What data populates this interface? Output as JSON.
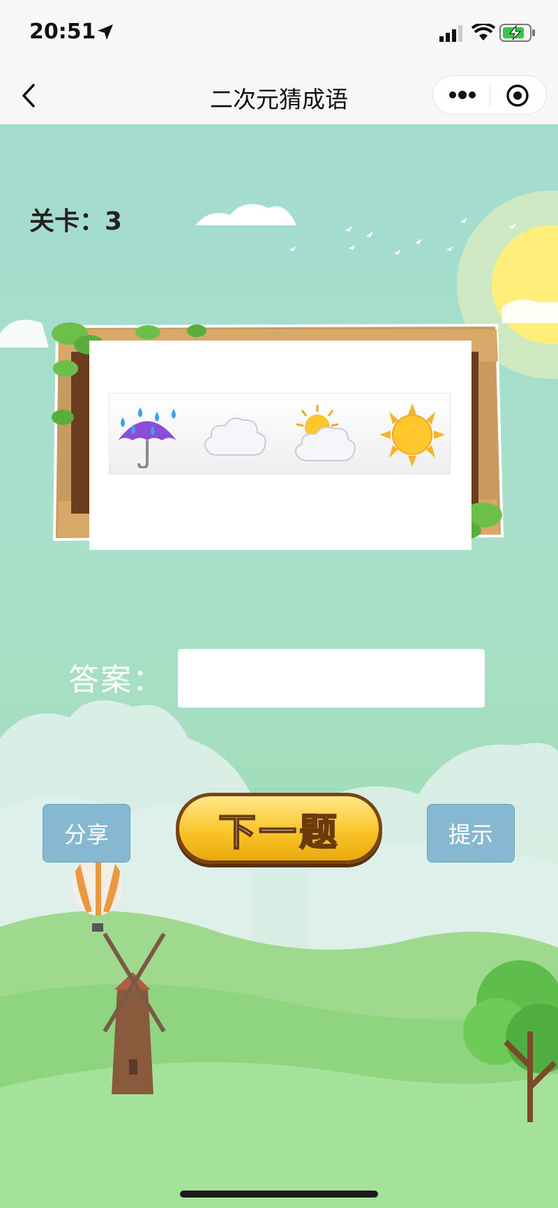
{
  "status_bar": {
    "time": "20:51"
  },
  "nav": {
    "title": "二次元猜成语"
  },
  "game": {
    "level_label": "关卡：3"
  },
  "puzzle": {
    "emoji": [
      "umbrella-with-rain-drops",
      "cloud",
      "sun-behind-cloud",
      "sun"
    ]
  },
  "answer": {
    "label": "答案：",
    "value": "",
    "placeholder": ""
  },
  "buttons": {
    "share": "分享",
    "next": "下一题",
    "hint": "提示"
  },
  "colors": {
    "button_blue": "#87b8d2",
    "next_gold": "#f9c52a",
    "sky": "#a3dccf",
    "grass": "#7fd28a"
  }
}
